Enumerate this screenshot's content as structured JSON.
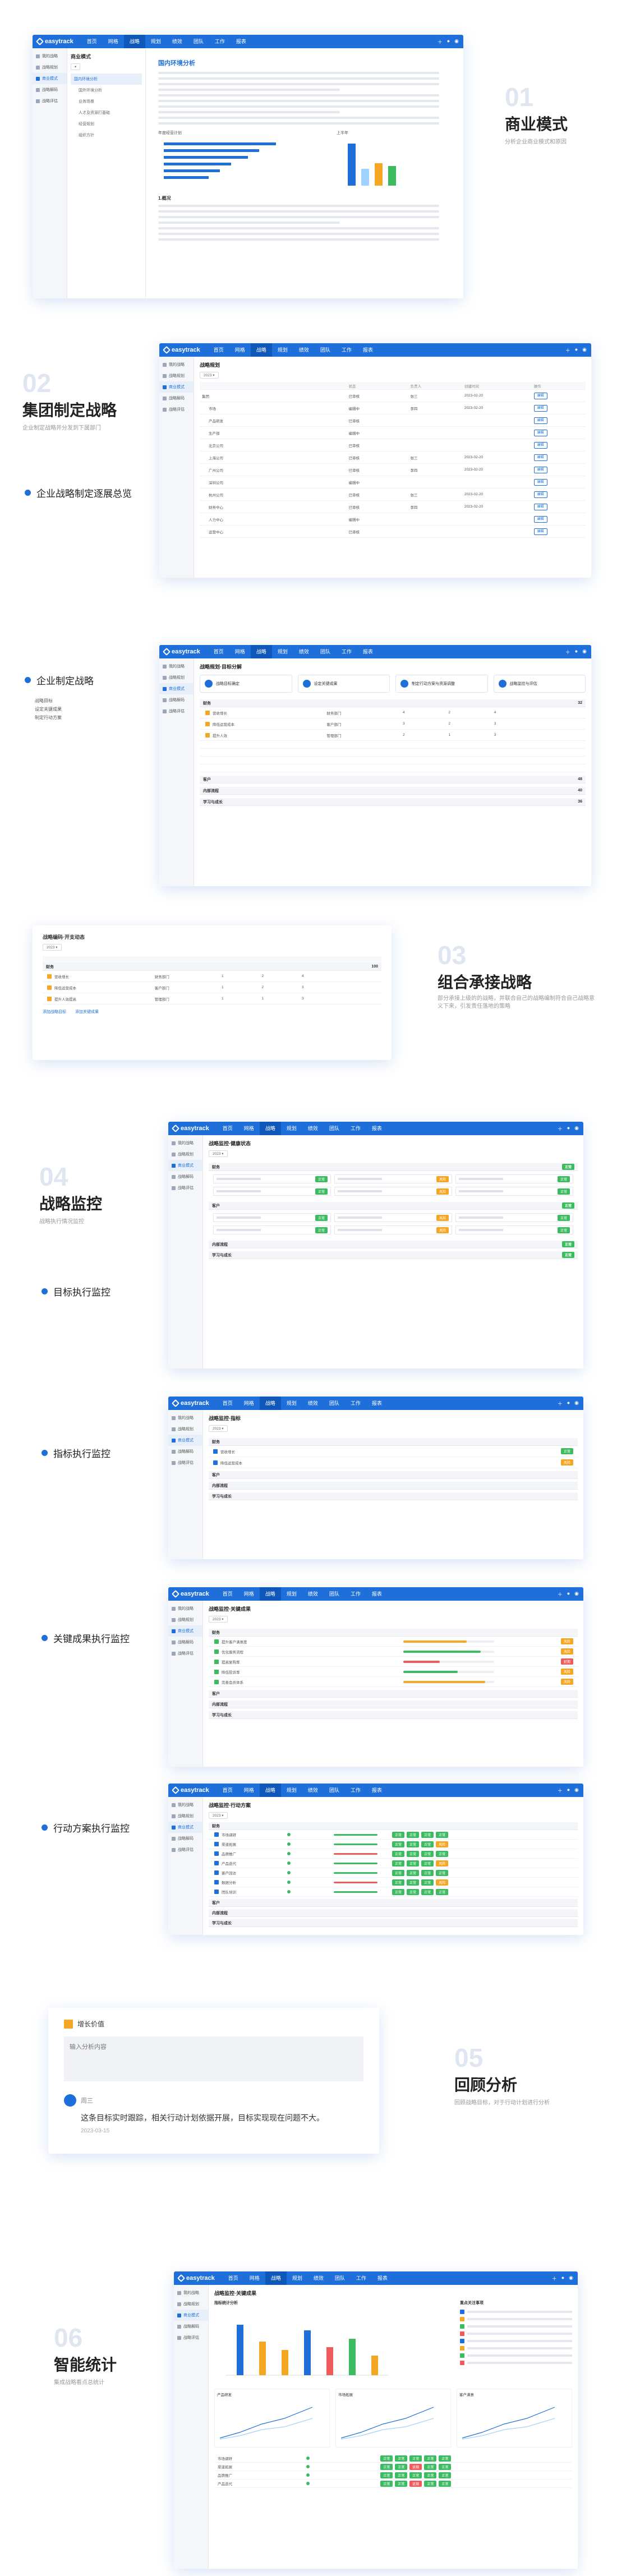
{
  "app": {
    "logo": "easytrack",
    "nav": [
      "首页",
      "网格",
      "战略",
      "规划",
      "绩效",
      "团队",
      "工作",
      "报表"
    ],
    "active_nav": "战略"
  },
  "side_menu": [
    "我的战略",
    "战略规划",
    "商业模式",
    "战略解码",
    "战略评估"
  ],
  "sec1": {
    "num": "01",
    "title": "商业模式",
    "sub": "分析企业商业模式和原因",
    "side": [
      "我的战略",
      "战略规划",
      "商业模式",
      "战略解码",
      "战略评估"
    ],
    "left_tab": "商业模式",
    "tree": [
      "国内环境分析",
      "国外环境分析",
      "业务场景",
      "人才及资源打基础",
      "经营规划",
      "组织方针"
    ],
    "doc_title": "国内环境分析",
    "chart_title_left": "年度经营计划",
    "chart_title_right": "上半年",
    "section2": "1.概况"
  },
  "sec2": {
    "num": "02",
    "title": "集团制定战略",
    "sub": "企业制定战略并分发到下属部门",
    "bullet": "企业战略制定逐展总览",
    "page_title": "战略规划",
    "cols": [
      "",
      "状态",
      "负责人",
      "创建时间",
      "操作"
    ],
    "rows": [
      {
        "name": "集团",
        "status": "已审核",
        "owner": "张三",
        "date": "2023-02-20"
      },
      {
        "name": "市场",
        "status": "编辑中",
        "owner": "李四",
        "date": "2023-02-20"
      },
      {
        "name": "产品研发",
        "status": "已审核",
        "owner": "",
        "date": ""
      },
      {
        "name": "生产部",
        "status": "编辑中",
        "owner": "",
        "date": ""
      },
      {
        "name": "北京公司",
        "status": "已审核",
        "owner": "",
        "date": ""
      },
      {
        "name": "上海公司",
        "status": "已审核",
        "owner": "张三",
        "date": "2023-02-20"
      },
      {
        "name": "广州公司",
        "status": "已审核",
        "owner": "李四",
        "date": "2023-02-20"
      },
      {
        "name": "深圳公司",
        "status": "编辑中",
        "owner": "",
        "date": ""
      },
      {
        "name": "杭州公司",
        "status": "已审核",
        "owner": "张三",
        "date": "2023-02-20"
      },
      {
        "name": "财务中心",
        "status": "已审核",
        "owner": "李四",
        "date": "2023-02-20"
      },
      {
        "name": "人力中心",
        "status": "编辑中",
        "owner": "",
        "date": ""
      },
      {
        "name": "运营中心",
        "status": "已审核",
        "owner": "",
        "date": ""
      }
    ],
    "op": "编辑"
  },
  "sec3a": {
    "bullet": "企业制定战略",
    "list": [
      "战略目标",
      "设定关键成果",
      "制定行动方案"
    ],
    "page_title": "战略规划·目标分解",
    "steps": [
      "战略目标确定",
      "设定关键成果",
      "制定行动方案与资源调整",
      "战略监控与评估"
    ],
    "groups": [
      "财务",
      "客户",
      "内部流程",
      "学习与成长"
    ],
    "items": [
      {
        "name": "营收增长",
        "dept": "财务部门",
        "a": "4",
        "b": "2",
        "c": "4"
      },
      {
        "name": "降低运营成本",
        "dept": "客户部门",
        "a": "3",
        "b": "2",
        "c": "3"
      },
      {
        "name": "提升人效",
        "dept": "管理部门",
        "a": "2",
        "b": "1",
        "c": "3"
      }
    ],
    "totals": [
      "32",
      "48",
      "40",
      "36"
    ]
  },
  "sec3": {
    "num": "03",
    "title": "组合承接战略",
    "sub": "部分承接上级的的战略，并联合自己的战略编制符合自己战略意义下来，引发责任落地的策略",
    "mini_title": "战略编码·开支动态",
    "mini_group": "财务",
    "mini_total": "100",
    "mini_items": [
      {
        "name": "营收增长",
        "dept": "财务部门",
        "a": "1",
        "b": "2",
        "c": "4"
      },
      {
        "name": "降低运营成本",
        "dept": "客户部门",
        "a": "1",
        "b": "2",
        "c": "3"
      },
      {
        "name": "提升人效提高",
        "dept": "管理部门",
        "a": "1",
        "b": "1",
        "c": "3"
      }
    ],
    "mini_links": [
      "添加战略目标",
      "添加关键成果"
    ]
  },
  "sec4": {
    "num": "04",
    "title": "战略监控",
    "sub": "战略执行情况监控",
    "bullets": [
      "目标执行监控",
      "指标执行监控",
      "关键成果执行监控",
      "行动方案执行监控"
    ],
    "p1_title": "战略监控·健康状态",
    "p2_title": "战略监控·指标",
    "p3_title": "战略监控·关键成果",
    "p4_title": "战略监控·行动方案",
    "groups": [
      "财务",
      "客户",
      "内部流程",
      "学习与成长"
    ],
    "status_ok": "正常",
    "status_warn": "风险",
    "status_bad": "延期",
    "kr_items": [
      "提升客户满意度",
      "优化服务流程",
      "提高复购率",
      "降低投诉率",
      "完善会员体系"
    ],
    "act_items": [
      "市场调研",
      "渠道拓展",
      "品牌推广",
      "产品迭代",
      "客户回访",
      "数据分析",
      "团队培训"
    ]
  },
  "sec5": {
    "num": "05",
    "title": "回顾分析",
    "sub": "回顾战略目标，对于行动计划进行分析",
    "card_label": "增长价值",
    "placeholder": "输入分析内容",
    "user": "周三",
    "comment": "这条目标实时跟踪，相关行动计划依据开展，目标实现现在问题不大。",
    "date": "2023-03-15"
  },
  "sec6": {
    "num": "06",
    "title": "智能统计",
    "sub": "集成战略看点总统计",
    "page_title": "战略监控·关键成果",
    "chart1": "指标统计分析",
    "chart2": "重点关注事项",
    "lines": [
      "产品研发",
      "市场拓展",
      "客户满意"
    ],
    "legend": [
      "上半年",
      "下半年"
    ]
  },
  "colors": {
    "primary": "#1e6fd9",
    "green": "#3dbb61",
    "orange": "#f5a623",
    "red": "#ef5b5b"
  }
}
